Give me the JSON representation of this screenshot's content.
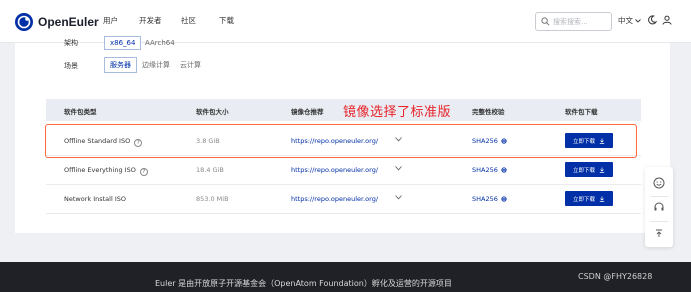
{
  "nav": {
    "logo_text": "OpenEuler",
    "links": [
      "用户",
      "开发者",
      "社区",
      "下载"
    ],
    "search_placeholder": "搜索搜索...",
    "lang": "中文",
    "accent": "#002fa7"
  },
  "filters": {
    "arch_label": "架构",
    "arch_options": [
      "x86_64",
      "AArch64"
    ],
    "arch_selected": "x86_64",
    "scene_label": "场景",
    "scene_options": [
      "服务器",
      "边缘计算",
      "云计算"
    ],
    "scene_selected": "服务器"
  },
  "table": {
    "headers": [
      "软件包类型",
      "软件包大小",
      "镜像仓推荐",
      "完整性校验",
      "软件包下载"
    ],
    "rows": [
      {
        "type": "Offline Standard ISO",
        "help": "?",
        "size": "3.8 GiB",
        "mirror": "https://repo.openeuler.org/",
        "checksum": "SHA256",
        "download": "立即下载"
      },
      {
        "type": "Offline Everything ISO",
        "help": "?",
        "size": "18.4 GiB",
        "mirror": "https://repo.openeuler.org/",
        "checksum": "SHA256",
        "download": "立即下载"
      },
      {
        "type": "Network Install ISO",
        "help": "",
        "size": "853.0 MiB",
        "mirror": "https://repo.openeuler.org/",
        "checksum": "SHA256",
        "download": "立即下载"
      }
    ]
  },
  "annotation": {
    "text": "镜像选择了标准版",
    "color": "#e8232a"
  },
  "footer": {
    "text": "Euler 是由开放原子开源基金会（OpenAtom Foundation）孵化及运营的开源项目"
  },
  "watermark": "CSDN @FHY26828"
}
